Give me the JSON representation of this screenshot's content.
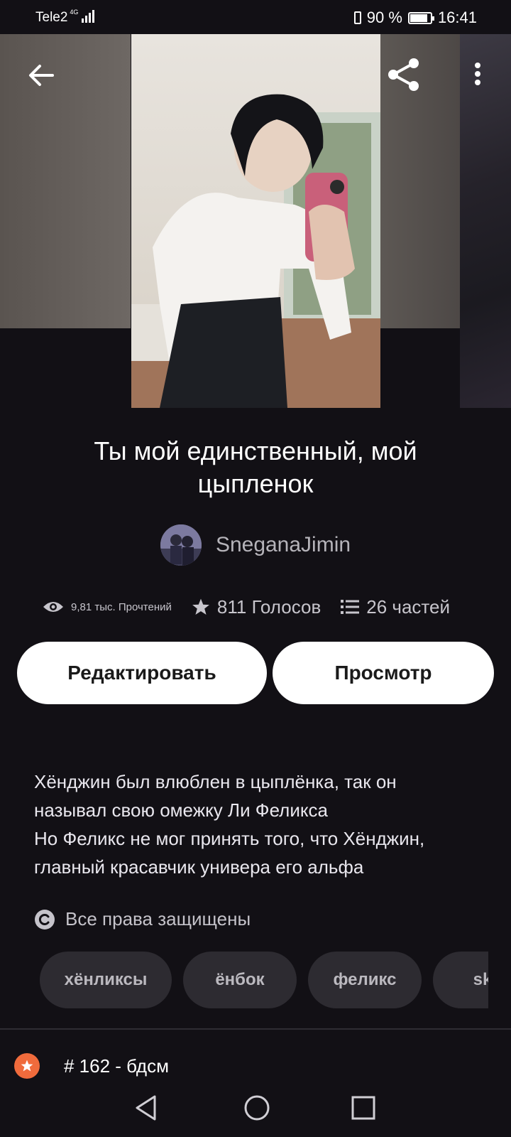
{
  "status_bar": {
    "carrier": "Tele2",
    "network": "4G",
    "battery": "90 %",
    "time": "16:41"
  },
  "icons": {
    "back": "arrow-left-icon",
    "share": "share-icon",
    "more": "more-vertical-icon",
    "views": "eye-icon",
    "votes": "star-icon",
    "parts": "list-icon",
    "copyright": "copyright-icon",
    "rank": "ranking-badge-icon"
  },
  "story": {
    "title": "Ты мой единственный, мой цыпленок",
    "author": "SneganaJimin",
    "stats": {
      "reads": "9,81 тыс. Прочтений",
      "votes": "811 Голосов",
      "parts": "26 частей"
    },
    "description": "Хёнджин был влюблен в цыплёнка, так он называл свою омежку Ли Феликса\nНо Феликс не мог принять того, что Хёнджин, главный красавчик универа его альфа",
    "rights": "Все права защищены",
    "tags": [
      "хёнликсы",
      "ёнбок",
      "феликс",
      "sk"
    ],
    "ranking": "# 162 - бдсм"
  },
  "actions": {
    "edit_label": "Редактировать",
    "view_label": "Просмотр"
  },
  "colors": {
    "background": "#121015",
    "button_bg": "#ffffff",
    "tag_bg": "#2d2b31",
    "rank_badge": "#f06b3c"
  }
}
